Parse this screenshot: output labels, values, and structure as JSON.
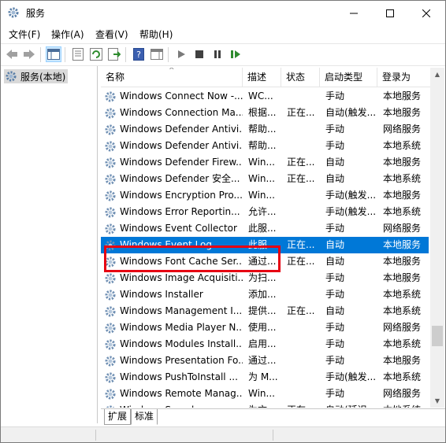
{
  "window": {
    "title": "服务",
    "controls": {
      "minimize": "minimize",
      "maximize": "maximize",
      "close": "close"
    }
  },
  "menu": [
    {
      "label": "文件(F)"
    },
    {
      "label": "操作(A)"
    },
    {
      "label": "查看(V)"
    },
    {
      "label": "帮助(H)"
    }
  ],
  "toolbar": {
    "icons": [
      "back-icon",
      "forward-icon",
      "show-hide-console-tree-icon",
      "properties-icon",
      "refresh-icon",
      "export-list-icon",
      "help-icon",
      "show-action-pane-icon",
      "start-service-icon",
      "stop-service-icon",
      "pause-service-icon",
      "resume-service-icon"
    ]
  },
  "tree": {
    "root_label": "服务(本地)"
  },
  "columns": {
    "name": "名称",
    "desc": "描述",
    "status": "状态",
    "startup_type": "启动类型",
    "logon_as": "登录为"
  },
  "services": [
    {
      "name": "Windows Connect Now -...",
      "desc": "WC...",
      "status": "",
      "startup_type": "手动",
      "logon_as": "本地服务"
    },
    {
      "name": "Windows Connection Ma...",
      "desc": "根据...",
      "status": "正在...",
      "startup_type": "自动(触发...",
      "logon_as": "本地服务"
    },
    {
      "name": "Windows Defender Antivi...",
      "desc": "帮助...",
      "status": "",
      "startup_type": "手动",
      "logon_as": "网络服务"
    },
    {
      "name": "Windows Defender Antivi...",
      "desc": "帮助...",
      "status": "",
      "startup_type": "手动",
      "logon_as": "本地系统"
    },
    {
      "name": "Windows Defender Firew...",
      "desc": "Win...",
      "status": "正在...",
      "startup_type": "自动",
      "logon_as": "本地服务"
    },
    {
      "name": "Windows Defender 安全...",
      "desc": "Win...",
      "status": "正在...",
      "startup_type": "自动",
      "logon_as": "本地系统"
    },
    {
      "name": "Windows Encryption Pro...",
      "desc": "Win...",
      "status": "",
      "startup_type": "手动(触发...",
      "logon_as": "本地服务"
    },
    {
      "name": "Windows Error Reportin...",
      "desc": "允许...",
      "status": "",
      "startup_type": "手动(触发...",
      "logon_as": "本地系统"
    },
    {
      "name": "Windows Event Collector",
      "desc": "此服...",
      "status": "",
      "startup_type": "手动",
      "logon_as": "网络服务"
    },
    {
      "name": "Windows Event Log",
      "desc": "此服...",
      "status": "正在...",
      "startup_type": "自动",
      "logon_as": "本地服务",
      "selected": true
    },
    {
      "name": "Windows Font Cache Ser...",
      "desc": "通过...",
      "status": "正在...",
      "startup_type": "自动",
      "logon_as": "本地服务"
    },
    {
      "name": "Windows Image Acquisiti...",
      "desc": "为扫...",
      "status": "",
      "startup_type": "手动",
      "logon_as": "本地服务"
    },
    {
      "name": "Windows Installer",
      "desc": "添加...",
      "status": "",
      "startup_type": "手动",
      "logon_as": "本地系统"
    },
    {
      "name": "Windows Management I...",
      "desc": "提供...",
      "status": "正在...",
      "startup_type": "自动",
      "logon_as": "本地系统"
    },
    {
      "name": "Windows Media Player N...",
      "desc": "使用...",
      "status": "",
      "startup_type": "手动",
      "logon_as": "网络服务"
    },
    {
      "name": "Windows Modules Install...",
      "desc": "启用...",
      "status": "",
      "startup_type": "手动",
      "logon_as": "本地系统"
    },
    {
      "name": "Windows Presentation Fo...",
      "desc": "通过...",
      "status": "",
      "startup_type": "手动",
      "logon_as": "本地服务"
    },
    {
      "name": "Windows PushToInstall ...",
      "desc": "为 M...",
      "status": "",
      "startup_type": "手动(触发...",
      "logon_as": "本地系统"
    },
    {
      "name": "Windows Remote Manag...",
      "desc": "Win...",
      "status": "",
      "startup_type": "手动",
      "logon_as": "网络服务"
    },
    {
      "name": "Windows Search",
      "desc": "为文...",
      "status": "正在...",
      "startup_type": "自动(延迟...",
      "logon_as": "本地系统"
    }
  ],
  "tabs": [
    {
      "label": "扩展"
    },
    {
      "label": "标准"
    }
  ],
  "colors": {
    "selection": "#0078d7",
    "annotation_box": "#e60012"
  }
}
